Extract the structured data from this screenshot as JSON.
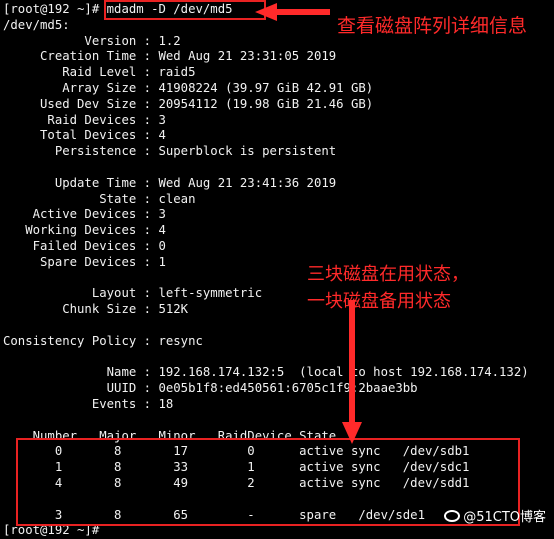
{
  "terminal": {
    "lines": [
      "[root@192 ~]# mdadm -D /dev/md5",
      "/dev/md5:",
      "           Version : 1.2",
      "     Creation Time : Wed Aug 21 23:31:05 2019",
      "        Raid Level : raid5",
      "        Array Size : 41908224 (39.97 GiB 42.91 GB)",
      "     Used Dev Size : 20954112 (19.98 GiB 21.46 GB)",
      "      Raid Devices : 3",
      "     Total Devices : 4",
      "       Persistence : Superblock is persistent",
      "",
      "       Update Time : Wed Aug 21 23:41:36 2019",
      "             State : clean",
      "    Active Devices : 3",
      "   Working Devices : 4",
      "    Failed Devices : 0",
      "     Spare Devices : 1",
      "",
      "            Layout : left-symmetric",
      "        Chunk Size : 512K",
      "",
      "Consistency Policy : resync",
      "",
      "              Name : 192.168.174.132:5  (local to host 192.168.174.132)",
      "              UUID : 0e05b1f8:ed450561:6705c1f9:2baae3bb",
      "            Events : 18",
      "",
      "    Number   Major   Minor   RaidDevice State",
      "       0       8       17        0      active sync   /dev/sdb1",
      "       1       8       33        1      active sync   /dev/sdc1",
      "       4       8       49        2      active sync   /dev/sdd1",
      "",
      "       3       8       65        -      spare   /dev/sde1",
      "[root@192 ~]#"
    ]
  },
  "annotations": {
    "command_note": "查看磁盘阵列详细信息",
    "status_note_line1": "三块磁盘在用状态，",
    "status_note_line2": "一块磁盘备用状态",
    "color": "#ff2a2a"
  },
  "watermark": {
    "text": "@51CTO博客",
    "icon": "cloud-logo-icon"
  }
}
